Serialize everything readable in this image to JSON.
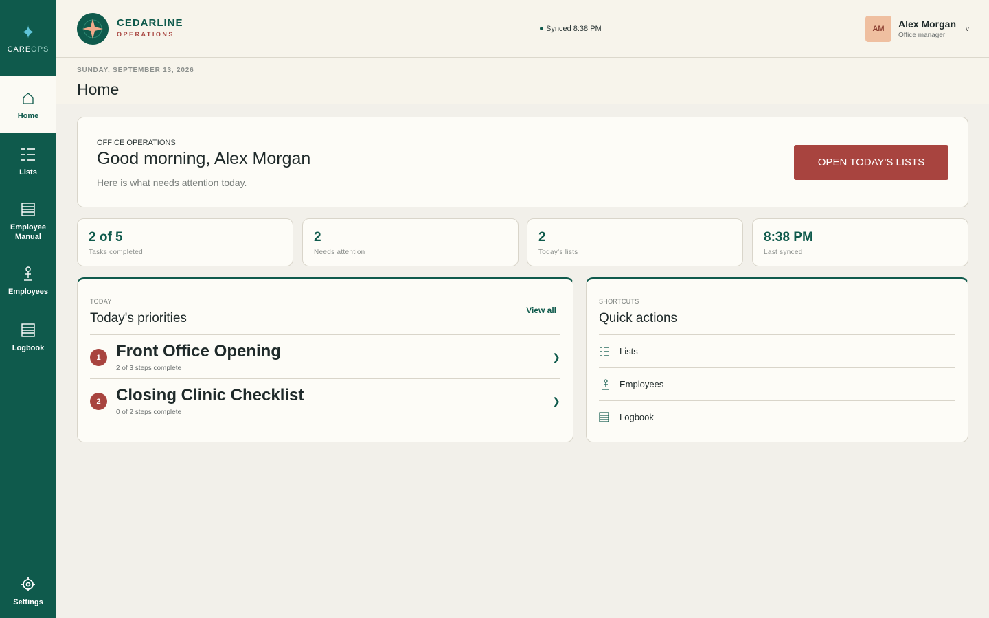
{
  "brand": {
    "app_word_1": "CARE",
    "app_word_2": "OPS",
    "org_line1": "CEDARLINE",
    "org_line2": "OPERATIONS"
  },
  "sidebar": {
    "items": [
      {
        "label": "Home",
        "icon": "home-icon",
        "active": true
      },
      {
        "label": "Lists",
        "icon": "list-icon"
      },
      {
        "label": "Employee Manual",
        "icon": "manual-icon"
      },
      {
        "label": "Employees",
        "icon": "person-icon"
      },
      {
        "label": "Logbook",
        "icon": "logbook-icon"
      }
    ],
    "settings_label": "Settings"
  },
  "header": {
    "sync_text": "Synced 8:38 PM",
    "user": {
      "initials": "AM",
      "name": "Alex Morgan",
      "role": "Office manager",
      "caret": "v"
    }
  },
  "page": {
    "date": "SUNDAY, SEPTEMBER 13, 2026",
    "title": "Home"
  },
  "hero": {
    "kicker": "OFFICE OPERATIONS",
    "greeting": "Good morning, Alex Morgan",
    "subtitle": "Here is what needs attention today.",
    "cta": "OPEN TODAY'S LISTS"
  },
  "stats": [
    {
      "value": "2 of 5",
      "label": "Tasks completed"
    },
    {
      "value": "2",
      "label": "Needs attention"
    },
    {
      "value": "2",
      "label": "Today's lists"
    },
    {
      "value": "8:38 PM",
      "label": "Last synced"
    }
  ],
  "priorities": {
    "kicker": "TODAY",
    "title": "Today's priorities",
    "view_all": "View all",
    "items": [
      {
        "num": "1",
        "name": "Front Office Opening",
        "progress": "2 of 3 steps complete"
      },
      {
        "num": "2",
        "name": "Closing Clinic Checklist",
        "progress": "0 of 2 steps complete"
      }
    ]
  },
  "shortcuts": {
    "kicker": "SHORTCUTS",
    "title": "Quick actions",
    "items": [
      {
        "label": "Lists",
        "icon": "list-icon"
      },
      {
        "label": "Employees",
        "icon": "person-icon"
      },
      {
        "label": "Logbook",
        "icon": "logbook-icon"
      }
    ]
  },
  "colors": {
    "primary": "#0f5a4c",
    "accent": "#a8443f",
    "background": "#f2f0ea"
  }
}
